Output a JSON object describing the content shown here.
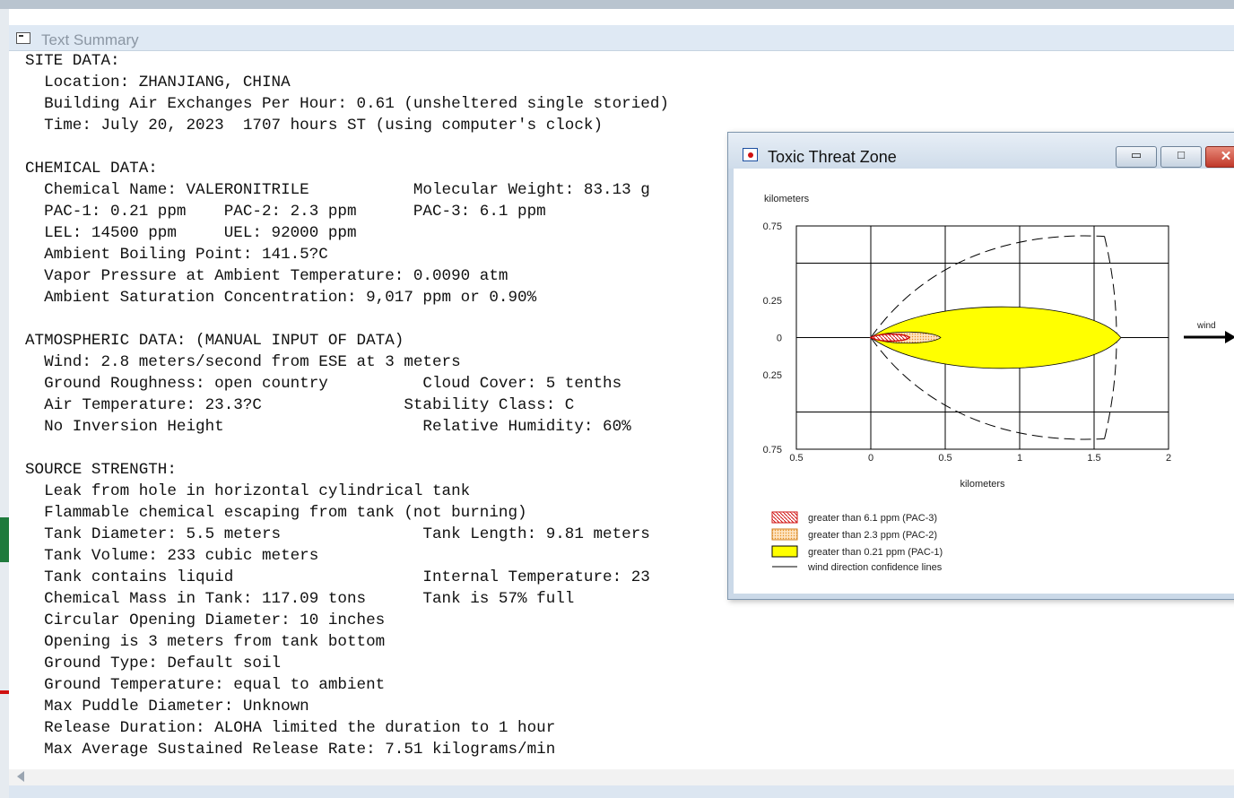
{
  "text_window": {
    "title": "Text Summary",
    "lines": [
      "SITE DATA:",
      "  Location: ZHANJIANG, CHINA",
      "  Building Air Exchanges Per Hour: 0.61 (unsheltered single storied)",
      "  Time: July 20, 2023  1707 hours ST (using computer's clock)",
      "",
      "CHEMICAL DATA:",
      "  Chemical Name: VALERONITRILE           Molecular Weight: 83.13 g",
      "  PAC-1: 0.21 ppm    PAC-2: 2.3 ppm      PAC-3: 6.1 ppm",
      "  LEL: 14500 ppm     UEL: 92000 ppm",
      "  Ambient Boiling Point: 141.5?C",
      "  Vapor Pressure at Ambient Temperature: 0.0090 atm",
      "  Ambient Saturation Concentration: 9,017 ppm or 0.90%",
      "",
      "ATMOSPHERIC DATA: (MANUAL INPUT OF DATA)",
      "  Wind: 2.8 meters/second from ESE at 3 meters",
      "  Ground Roughness: open country          Cloud Cover: 5 tenths",
      "  Air Temperature: 23.3?C               Stability Class: C",
      "  No Inversion Height                     Relative Humidity: 60%",
      "",
      "SOURCE STRENGTH:",
      "  Leak from hole in horizontal cylindrical tank",
      "  Flammable chemical escaping from tank (not burning)",
      "  Tank Diameter: 5.5 meters               Tank Length: 9.81 meters",
      "  Tank Volume: 233 cubic meters",
      "  Tank contains liquid                    Internal Temperature: 23",
      "  Chemical Mass in Tank: 117.09 tons      Tank is 57% full",
      "  Circular Opening Diameter: 10 inches",
      "  Opening is 3 meters from tank bottom",
      "  Ground Type: Default soil",
      "  Ground Temperature: equal to ambient",
      "  Max Puddle Diameter: Unknown",
      "  Release Duration: ALOHA limited the duration to 1 hour",
      "  Max Average Sustained Release Rate: 7.51 kilograms/min"
    ]
  },
  "threat_window": {
    "title": "Toxic Threat Zone",
    "buttons": {
      "minimize": "▭",
      "maximize": "□",
      "close": "✕"
    },
    "chart": {
      "y_unit": "kilometers",
      "x_unit": "kilometers",
      "wind_label": "wind",
      "x_ticks": [
        "0.5",
        "0",
        "0.5",
        "1",
        "1.5",
        "2"
      ],
      "y_ticks": [
        "0.75",
        "0.25",
        "0",
        "0.25",
        "0.75"
      ],
      "legend": [
        "greater than 6.1 ppm (PAC-3)",
        "greater than 2.3 ppm (PAC-2)",
        "greater than 0.21 ppm (PAC-1)",
        "wind direction confidence lines"
      ]
    }
  },
  "chart_data": {
    "type": "area",
    "xlabel": "kilometers",
    "ylabel": "kilometers",
    "xlim": [
      -0.5,
      2
    ],
    "ylim": [
      -0.75,
      0.75
    ],
    "grid": true,
    "legend_position": "bottom-left",
    "zones": [
      {
        "name": "greater than 6.1 ppm (PAC-3)",
        "x_start": 0,
        "x_end": 0.26,
        "half_width": 0.025,
        "color": "#d01010",
        "fill": "hatched"
      },
      {
        "name": "greater than 2.3 ppm (PAC-2)",
        "x_start": 0,
        "x_end": 0.47,
        "half_width": 0.04,
        "color": "#f0a040",
        "fill": "dotted"
      },
      {
        "name": "greater than 0.21 ppm (PAC-1)",
        "x_start": 0,
        "x_end": 1.68,
        "half_width": 0.22,
        "color": "#ffff00",
        "fill": "solid"
      }
    ],
    "confidence_lines": {
      "name": "wind direction confidence lines",
      "x_end": 1.66,
      "half_width_max": 0.68
    }
  }
}
